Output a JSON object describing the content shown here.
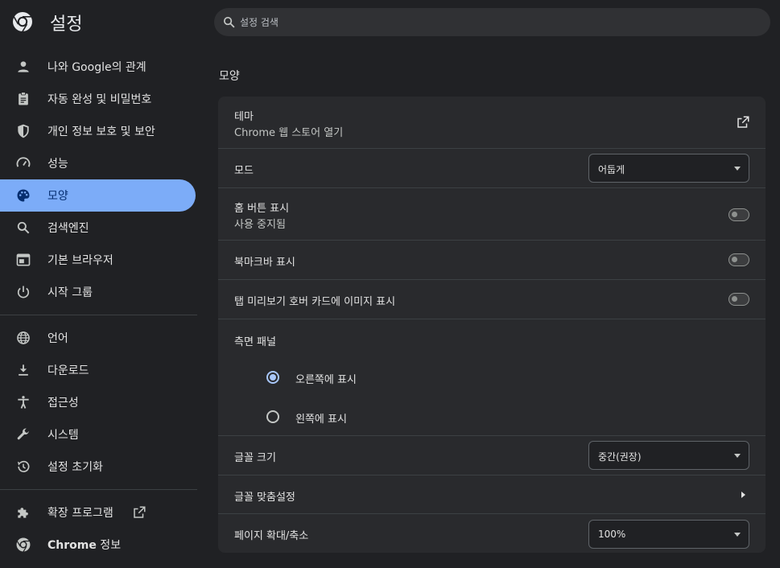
{
  "header": {
    "title": "설정",
    "search_placeholder": "설정 검색"
  },
  "sidebar": {
    "items": [
      {
        "label": "나와 Google의 관계",
        "icon": "person-icon",
        "active": false
      },
      {
        "label": "자동 완성 및 비밀번호",
        "icon": "clipboard-icon",
        "active": false
      },
      {
        "label": "개인 정보 보호 및 보안",
        "icon": "shield-icon",
        "active": false
      },
      {
        "label": "성능",
        "icon": "speedometer-icon",
        "active": false
      },
      {
        "label": "모양",
        "icon": "palette-icon",
        "active": true
      },
      {
        "label": "검색엔진",
        "icon": "search-icon",
        "active": false
      },
      {
        "label": "기본 브라우저",
        "icon": "browser-icon",
        "active": false
      },
      {
        "label": "시작 그룹",
        "icon": "power-icon",
        "active": false
      }
    ],
    "items2": [
      {
        "label": "언어",
        "icon": "globe-icon"
      },
      {
        "label": "다운로드",
        "icon": "download-icon"
      },
      {
        "label": "접근성",
        "icon": "accessibility-icon"
      },
      {
        "label": "시스템",
        "icon": "wrench-icon"
      },
      {
        "label": "설정 초기화",
        "icon": "restore-icon"
      }
    ],
    "items3": [
      {
        "label": "확장 프로그램",
        "icon": "puzzle-icon"
      },
      {
        "label_bold": "Chrome",
        "label_rest": " 정보",
        "icon": "chrome-icon"
      }
    ]
  },
  "main": {
    "section_title": "모양",
    "theme": {
      "label": "테마",
      "sublabel": "Chrome 웹 스토어 열기"
    },
    "mode": {
      "label": "모드",
      "value": "어둡게"
    },
    "home_button": {
      "label": "홈 버튼 표시",
      "sublabel": "사용 중지됨",
      "enabled": false
    },
    "bookmarks_bar": {
      "label": "북마크바 표시",
      "enabled": false
    },
    "tab_preview": {
      "label": "탭 미리보기 호버 카드에 이미지 표시",
      "enabled": false
    },
    "side_panel": {
      "label": "측면 패널",
      "options": [
        {
          "label": "오른쪽에 표시",
          "checked": true
        },
        {
          "label": "왼쪽에 표시",
          "checked": false
        }
      ]
    },
    "font_size": {
      "label": "글꼴 크기",
      "value": "중간(권장)"
    },
    "customize_fonts": {
      "label": "글꼴 맞춤설정"
    },
    "page_zoom": {
      "label": "페이지 확대/축소",
      "value": "100%"
    }
  },
  "colors": {
    "background": "#202124",
    "card": "#292a2d",
    "accent": "#7cacf8",
    "radio_checked": "#a8c7fa"
  }
}
